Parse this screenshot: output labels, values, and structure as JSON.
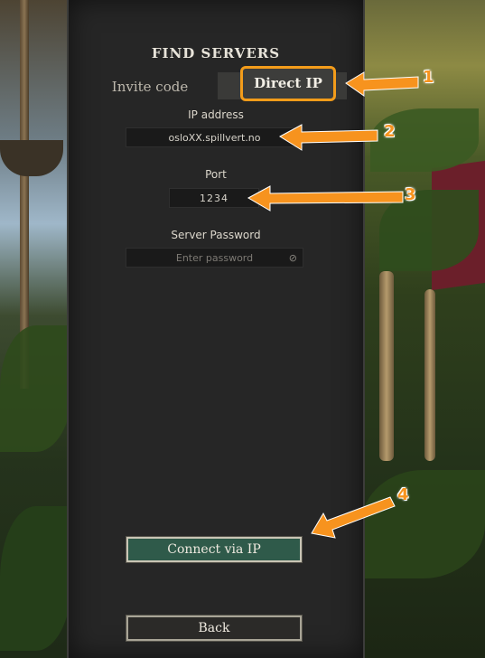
{
  "panel": {
    "title": "FIND SERVERS",
    "tabs": {
      "invite_code": "Invite code",
      "direct_ip": "Direct IP"
    },
    "ip": {
      "label": "IP address",
      "value": "osloXX.spillvert.no"
    },
    "port": {
      "label": "Port",
      "value": "1234"
    },
    "password": {
      "label": "Server Password",
      "placeholder": "Enter password"
    },
    "connect_label": "Connect via IP",
    "back_label": "Back"
  },
  "annotations": {
    "n1": "1",
    "n2": "2",
    "n3": "3",
    "n4": "4",
    "color": "#f7931e"
  },
  "colors": {
    "accent": "#f39c1a",
    "connect_button": "#2f5a4a"
  }
}
